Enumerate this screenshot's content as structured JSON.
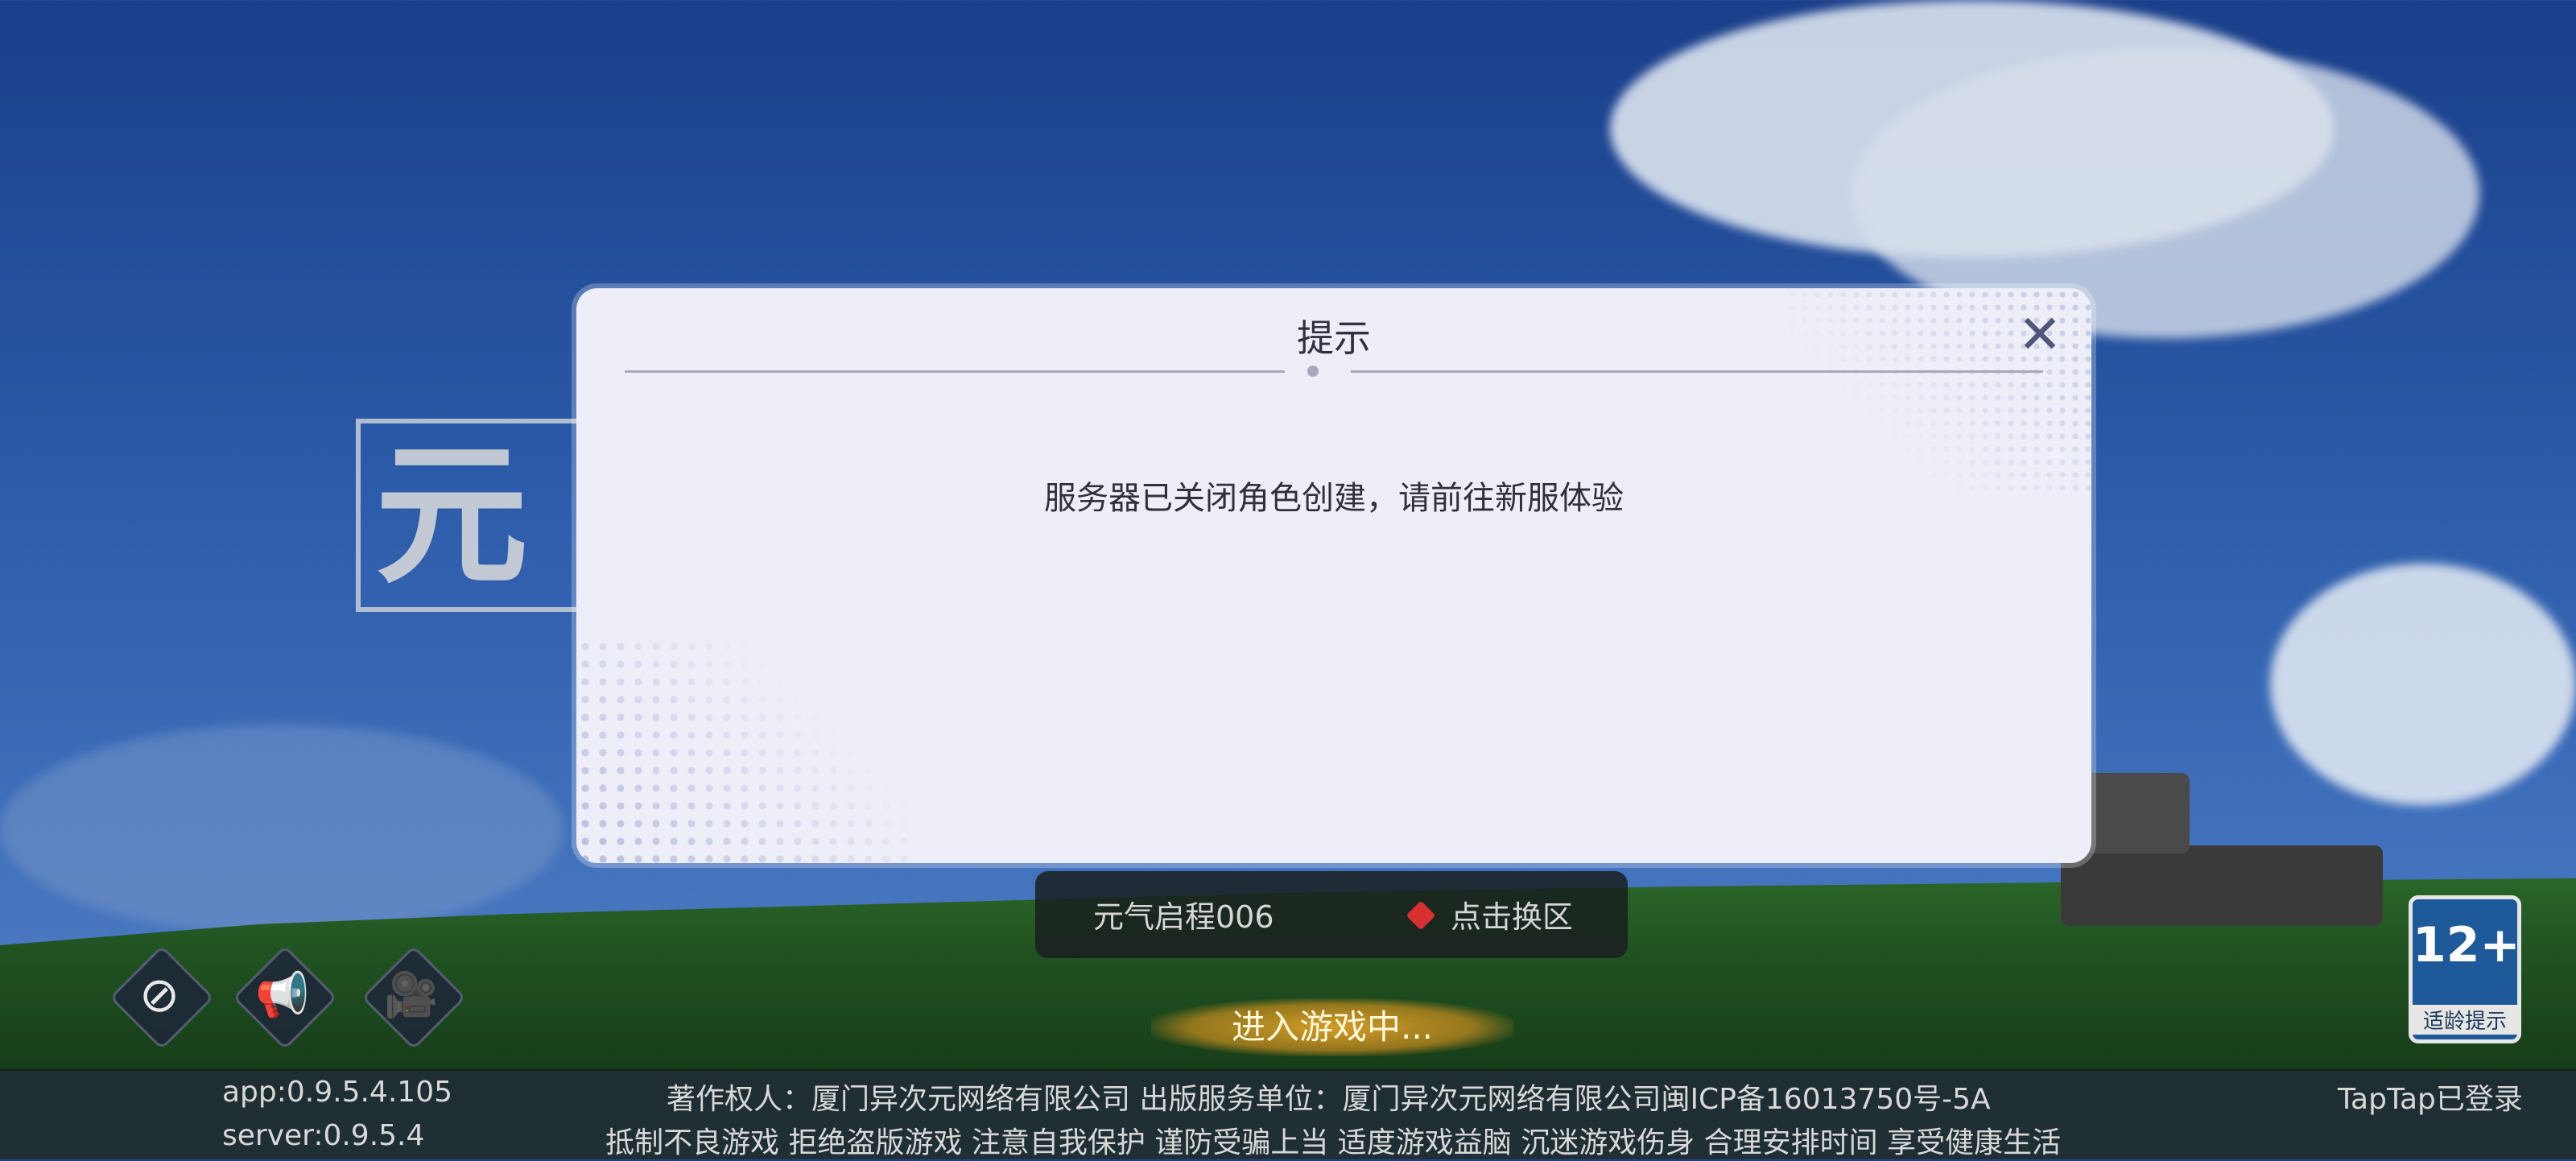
{
  "logo_text": "元气",
  "dialog": {
    "title": "提示",
    "message": "服务器已关闭角色创建，请前往新服体验",
    "close_icon": "close-icon"
  },
  "side_icons": [
    "block-icon",
    "megaphone-icon",
    "camera-icon"
  ],
  "server": {
    "name": "元气启程006",
    "switch_label": "点击换区",
    "status_color": "#d83030"
  },
  "enter_label": "进入游戏中...",
  "age_rating": {
    "number": "12+",
    "label": "适龄提示"
  },
  "footer": {
    "app_version": "app:0.9.5.4.105",
    "server_version": "server:0.9.5.4",
    "copyright": "著作权人：厦门异次元网络有限公司  出版服务单位：厦门异次元网络有限公司闽ICP备16013750号-5A",
    "health_notice": "抵制不良游戏  拒绝盗版游戏  注意自我保护  谨防受骗上当  适度游戏益脑  沉迷游戏伤身  合理安排时间  享受健康生活",
    "taptap_status": "TapTap已登录"
  }
}
